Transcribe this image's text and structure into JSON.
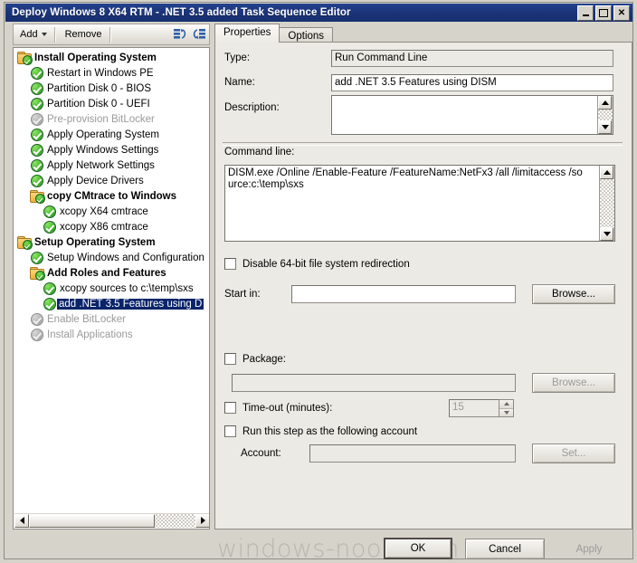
{
  "window": {
    "title": "Deploy Windows 8 X64 RTM - .NET 3.5 added Task Sequence Editor",
    "minimize_label": "Minimize",
    "maximize_label": "Maximize",
    "close_label": "Close"
  },
  "toolbar": {
    "add_label": "Add",
    "remove_label": "Remove",
    "icon1": "move-up-icon",
    "icon2": "move-down-icon"
  },
  "tree": {
    "items": [
      {
        "label": "Install Operating System",
        "indent": 0,
        "type": "group",
        "state": "enabled",
        "selected": false
      },
      {
        "label": "Restart in Windows PE",
        "indent": 1,
        "type": "step",
        "state": "enabled",
        "selected": false
      },
      {
        "label": "Partition Disk 0 - BIOS",
        "indent": 1,
        "type": "step",
        "state": "enabled",
        "selected": false
      },
      {
        "label": "Partition Disk 0 - UEFI",
        "indent": 1,
        "type": "step",
        "state": "enabled",
        "selected": false
      },
      {
        "label": "Pre-provision BitLocker",
        "indent": 1,
        "type": "step",
        "state": "disabled",
        "selected": false
      },
      {
        "label": "Apply Operating System",
        "indent": 1,
        "type": "step",
        "state": "enabled",
        "selected": false
      },
      {
        "label": "Apply Windows Settings",
        "indent": 1,
        "type": "step",
        "state": "enabled",
        "selected": false
      },
      {
        "label": "Apply Network Settings",
        "indent": 1,
        "type": "step",
        "state": "enabled",
        "selected": false
      },
      {
        "label": "Apply Device Drivers",
        "indent": 1,
        "type": "step",
        "state": "enabled",
        "selected": false
      },
      {
        "label": "copy CMtrace to Windows",
        "indent": 1,
        "type": "group",
        "state": "enabled",
        "selected": false
      },
      {
        "label": "xcopy X64 cmtrace",
        "indent": 2,
        "type": "step",
        "state": "enabled",
        "selected": false
      },
      {
        "label": "xcopy X86 cmtrace",
        "indent": 2,
        "type": "step",
        "state": "enabled",
        "selected": false
      },
      {
        "label": "Setup Operating System",
        "indent": 0,
        "type": "group",
        "state": "enabled",
        "selected": false
      },
      {
        "label": "Setup Windows and Configuration",
        "indent": 1,
        "type": "step",
        "state": "enabled",
        "selected": false
      },
      {
        "label": "Add Roles and Features",
        "indent": 1,
        "type": "group",
        "state": "enabled",
        "selected": false
      },
      {
        "label": "xcopy sources to c:\\temp\\sxs",
        "indent": 2,
        "type": "step",
        "state": "enabled",
        "selected": false
      },
      {
        "label": "add .NET 3.5 Features using D",
        "indent": 2,
        "type": "step",
        "state": "enabled",
        "selected": true
      },
      {
        "label": "Enable BitLocker",
        "indent": 1,
        "type": "step",
        "state": "disabled",
        "selected": false
      },
      {
        "label": "Install Applications",
        "indent": 1,
        "type": "step",
        "state": "disabled",
        "selected": false
      }
    ]
  },
  "tabs": {
    "properties": "Properties",
    "options": "Options"
  },
  "properties": {
    "type_label": "Type:",
    "type_value": "Run Command Line",
    "name_label": "Name:",
    "name_value": "add .NET 3.5 Features using DISM",
    "description_label": "Description:",
    "description_value": "",
    "command_line_label": "Command line:",
    "command_line_value": "DISM.exe /Online /Enable-Feature /FeatureName:NetFx3 /all /limitaccess /source:c:\\temp\\sxs",
    "disable_redirection_label": "Disable 64-bit file system redirection",
    "disable_redirection_checked": false,
    "start_in_label": "Start in:",
    "start_in_value": "",
    "start_in_browse_label": "Browse...",
    "package_label": "Package:",
    "package_checked": false,
    "package_value": "",
    "package_browse_label": "Browse...",
    "timeout_label": "Time-out (minutes):",
    "timeout_checked": false,
    "timeout_value": "15",
    "run_as_label": "Run this step as the following account",
    "run_as_checked": false,
    "account_label": "Account:",
    "account_value": "",
    "account_set_label": "Set..."
  },
  "footer": {
    "ok_label": "OK",
    "cancel_label": "Cancel",
    "apply_label": "Apply",
    "watermark": "windows-noob.com"
  },
  "colors": {
    "titlebar": "#1b3377",
    "selection": "#0a246a",
    "face": "#eceae4",
    "window_bg": "#d6d3cb",
    "check_green": "#35a821",
    "folder_yellow": "#ecb23f",
    "watermark": "#b9b6ae"
  }
}
